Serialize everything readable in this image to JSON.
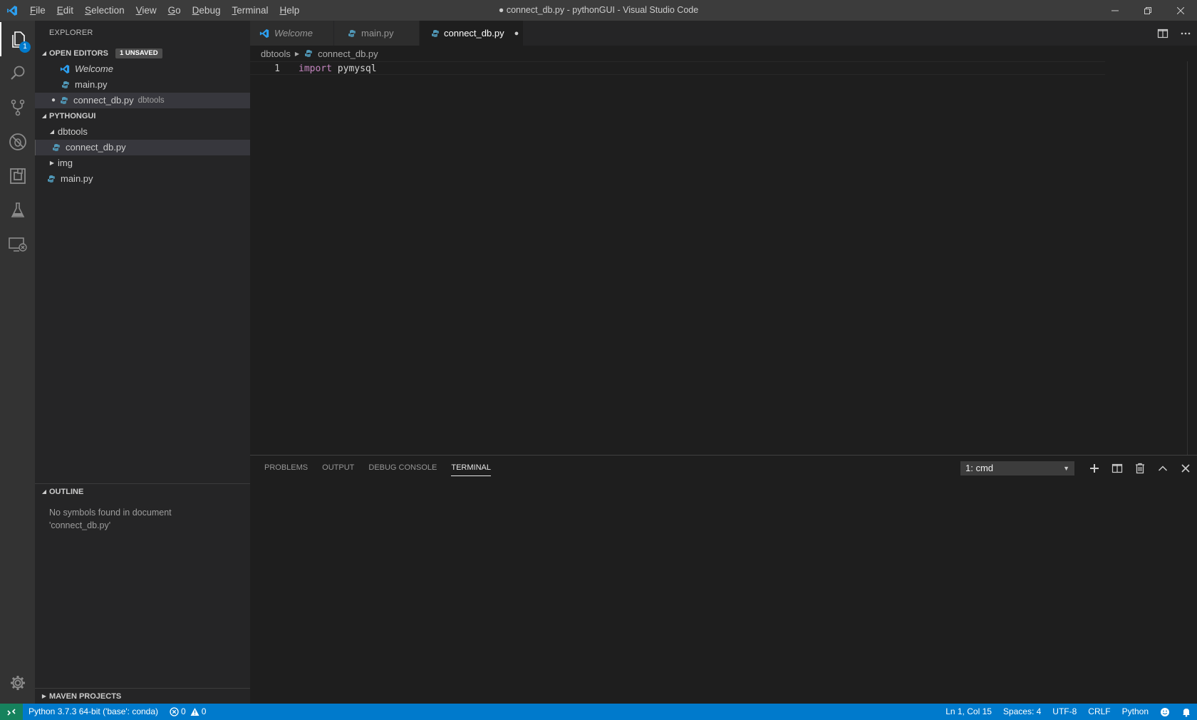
{
  "window": {
    "title": "● connect_db.py - pythonGUI - Visual Studio Code"
  },
  "menu": {
    "items": [
      {
        "first": "F",
        "rest": "ile"
      },
      {
        "first": "E",
        "rest": "dit"
      },
      {
        "first": "S",
        "rest": "election"
      },
      {
        "first": "V",
        "rest": "iew"
      },
      {
        "first": "G",
        "rest": "o"
      },
      {
        "first": "D",
        "rest": "ebug"
      },
      {
        "first": "T",
        "rest": "erminal"
      },
      {
        "first": "H",
        "rest": "elp"
      }
    ]
  },
  "activity": {
    "explorer_badge": "1",
    "icons": [
      "files-icon",
      "search-icon",
      "source-control-icon",
      "debug-icon",
      "extensions-icon",
      "test-icon",
      "remote-explorer-icon",
      "settings-gear-icon"
    ]
  },
  "sidebar": {
    "title": "EXPLORER",
    "open_editors": {
      "label": "OPEN EDITORS",
      "badge": "1 UNSAVED",
      "items": [
        {
          "label": "Welcome",
          "desc": ""
        },
        {
          "label": "main.py",
          "desc": ""
        },
        {
          "label": "connect_db.py",
          "desc": "dbtools"
        }
      ]
    },
    "workspace": {
      "label": "PYTHONGUI",
      "folder1": "dbtools",
      "file1": "connect_db.py",
      "folder2": "img",
      "file2": "main.py"
    },
    "outline": {
      "label": "OUTLINE",
      "message_line1": "No symbols found in document",
      "message_line2": "'connect_db.py'"
    },
    "maven": {
      "label": "MAVEN PROJECTS"
    }
  },
  "editor": {
    "tabs": [
      {
        "label": "Welcome"
      },
      {
        "label": "main.py"
      },
      {
        "label": "connect_db.py",
        "dirty_marker": "●"
      }
    ],
    "breadcrumb": {
      "folder": "dbtools",
      "file": "connect_db.py"
    },
    "lines": [
      {
        "number": "1",
        "keyword": "import",
        "rest": " pymysql"
      }
    ]
  },
  "panel": {
    "tabs": [
      "PROBLEMS",
      "OUTPUT",
      "DEBUG CONSOLE",
      "TERMINAL"
    ],
    "active_tab": "TERMINAL",
    "terminal_select": "1: cmd"
  },
  "status": {
    "interpreter": "Python 3.7.3 64-bit ('base': conda)",
    "errors": "0",
    "warnings": "0",
    "position": "Ln 1, Col 15",
    "spaces": "Spaces: 4",
    "encoding": "UTF-8",
    "eol": "CRLF",
    "language": "Python"
  },
  "colors": {
    "accent": "#007acc",
    "remote": "#16825d",
    "python_icon": "#519aba",
    "vscode_icon": "#2c9ff0",
    "keyword": "#c586c0"
  }
}
